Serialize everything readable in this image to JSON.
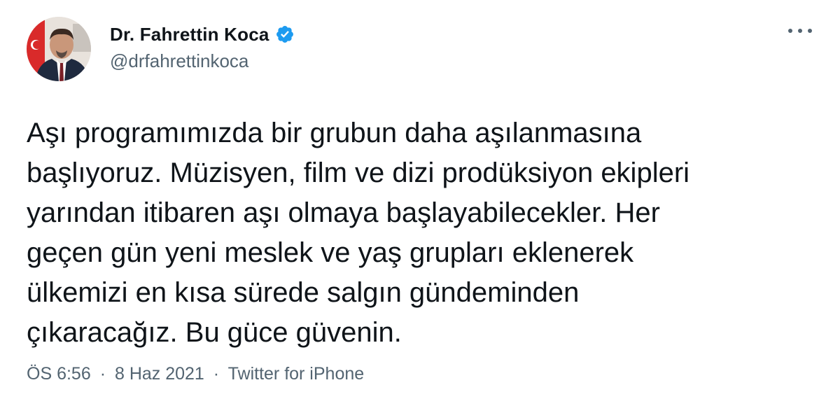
{
  "author": {
    "display_name": "Dr. Fahrettin Koca",
    "handle": "@drfahrettinkoca",
    "verified": true,
    "verified_color": "#1d9bf0"
  },
  "menu": {
    "icon": "more-horizontal-icon"
  },
  "tweet": {
    "lines": [
      "Aşı programımızda bir grubun daha aşılanmasına",
      "başlıyoruz. Müzisyen, film ve dizi prodüksiyon ekipleri",
      "yarından itibaren aşı olmaya başlayabilecekler. Her",
      "geçen gün yeni meslek ve yaş grupları eklenerek",
      "ülkemizi en kısa sürede salgın gündeminden",
      "çıkaracağız. Bu güce güvenin."
    ]
  },
  "meta": {
    "time": "ÖS 6:56",
    "separator": "·",
    "date": "8 Haz 2021",
    "source": "Twitter for iPhone"
  }
}
